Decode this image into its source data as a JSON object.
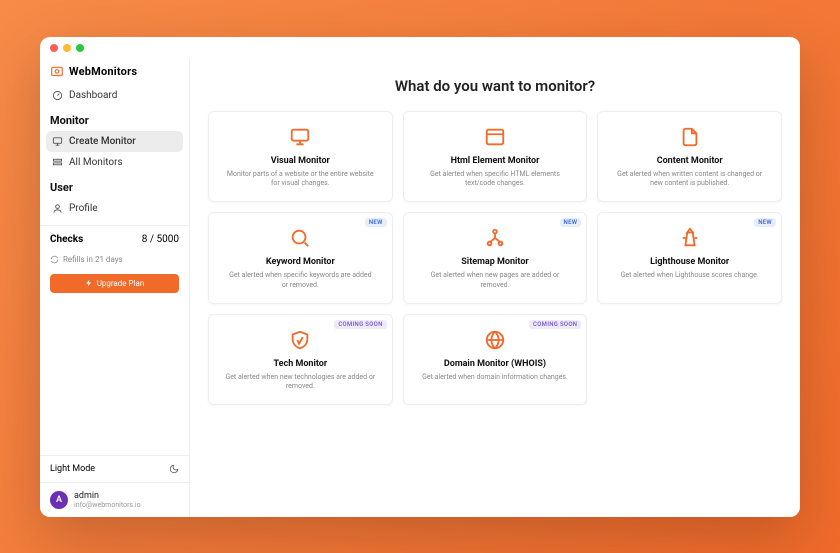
{
  "brand": {
    "name": "WebMonitors"
  },
  "nav": {
    "dashboard": "Dashboard",
    "section_monitor": "Monitor",
    "create_monitor": "Create Monitor",
    "all_monitors": "All Monitors",
    "section_user": "User",
    "profile": "Profile"
  },
  "checks": {
    "label": "Checks",
    "used": "8",
    "sep": " / ",
    "limit": "5000"
  },
  "refill": {
    "text": "Refills in 21 days"
  },
  "upgrade": {
    "label": "Upgrade Plan"
  },
  "mode": {
    "label": "Light Mode"
  },
  "user": {
    "initial": "A",
    "name": "admin",
    "email": "info@webmonitors.io"
  },
  "page": {
    "title": "What do you want to monitor?"
  },
  "badges": {
    "new": "NEW",
    "soon": "COMING SOON"
  },
  "cards": {
    "visual": {
      "title": "Visual Monitor",
      "desc": "Monitor parts of a website or the entire website for visual changes."
    },
    "html": {
      "title": "Html Element Monitor",
      "desc": "Get alerted when specific HTML elements text/code changes."
    },
    "content": {
      "title": "Content Monitor",
      "desc": "Get alerted when written content is changed or new content is published."
    },
    "keyword": {
      "title": "Keyword Monitor",
      "desc": "Get alerted when specific keywords are added or removed."
    },
    "sitemap": {
      "title": "Sitemap Monitor",
      "desc": "Get alerted when new pages are added or removed."
    },
    "lighthouse": {
      "title": "Lighthouse Monitor",
      "desc": "Get alerted when Lighthouse scores change."
    },
    "tech": {
      "title": "Tech Monitor",
      "desc": "Get alerted when new technologies are added or removed."
    },
    "domain": {
      "title": "Domain Monitor (WHOIS)",
      "desc": "Get alerted when domain information changes."
    }
  }
}
